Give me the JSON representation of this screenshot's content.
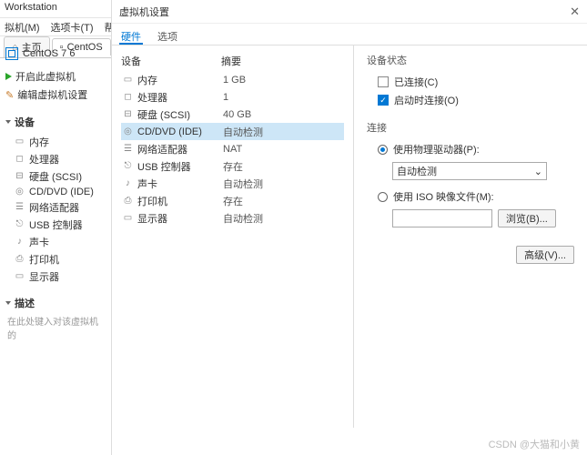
{
  "app": {
    "title": "Workstation"
  },
  "menu": {
    "vm": "拟机(M)",
    "tabs": "选项卡(T)",
    "help": "帮助(H"
  },
  "tabs": {
    "home": "主页",
    "vm": "CentOS"
  },
  "vm": {
    "name": "CentOS 7 6",
    "power_on": "开启此虚拟机",
    "edit": "编辑虚拟机设置"
  },
  "sections": {
    "devices": "设备",
    "desc": "描述"
  },
  "devlist": [
    "内存",
    "处理器",
    "硬盘 (SCSI)",
    "CD/DVD (IDE)",
    "网络适配器",
    "USB 控制器",
    "声卡",
    "打印机",
    "显示器"
  ],
  "desc_ph": "在此处键入对该虚拟机的",
  "dialog": {
    "title": "虚拟机设置",
    "tab_hw": "硬件",
    "tab_opt": "选项",
    "col_dev": "设备",
    "col_sum": "摘要"
  },
  "rows": [
    {
      "name": "内存",
      "sum": "1 GB"
    },
    {
      "name": "处理器",
      "sum": "1"
    },
    {
      "name": "硬盘 (SCSI)",
      "sum": "40 GB"
    },
    {
      "name": "CD/DVD (IDE)",
      "sum": "自动检测"
    },
    {
      "name": "网络适配器",
      "sum": "NAT"
    },
    {
      "name": "USB 控制器",
      "sum": "存在"
    },
    {
      "name": "声卡",
      "sum": "自动检测"
    },
    {
      "name": "打印机",
      "sum": "存在"
    },
    {
      "name": "显示器",
      "sum": "自动检测"
    }
  ],
  "right": {
    "status": "设备状态",
    "connected": "已连接(C)",
    "auto": "启动时连接(O)",
    "connection": "连接",
    "use_phys": "使用物理驱动器(P):",
    "auto_detect": "自动检测",
    "use_iso": "使用 ISO 映像文件(M):",
    "browse": "浏览(B)...",
    "advanced": "高级(V)..."
  },
  "watermark": "CSDN @大猫和小黄"
}
